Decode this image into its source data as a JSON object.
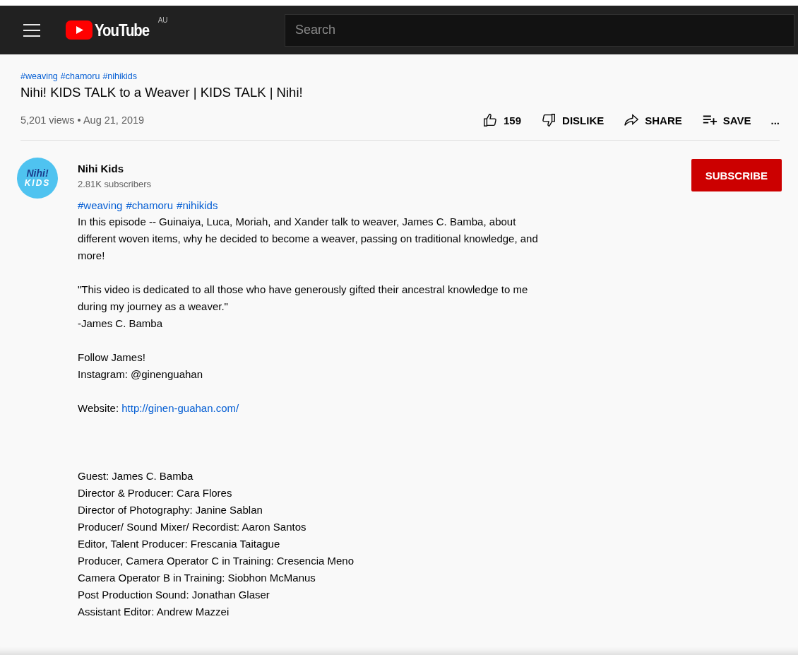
{
  "header": {
    "logo_text": "YouTube",
    "region": "AU",
    "search": {
      "placeholder": "Search"
    }
  },
  "video": {
    "hashtags": [
      "#weaving",
      "#chamoru",
      "#nihikids"
    ],
    "title": "Nihi! KIDS TALK to a Weaver | KIDS TALK | Nihi!",
    "meta": "5,201 views • Aug 21, 2019",
    "actions": [
      {
        "kind": "like",
        "label": "159"
      },
      {
        "kind": "dislike",
        "label": "DISLIKE"
      },
      {
        "kind": "share",
        "label": "SHARE"
      },
      {
        "kind": "save",
        "label": "SAVE"
      },
      {
        "kind": "more",
        "label": "..."
      }
    ]
  },
  "channel": {
    "name": "Nihi Kids",
    "avatar_text": [
      "Nihi!",
      "KIDS"
    ],
    "subscribers": "2.81K subscribers",
    "subscribe": "SUBSCRIBE"
  },
  "description": {
    "hashtags": [
      "#weaving",
      "#chamoru",
      "#nihikids"
    ],
    "blocks": [
      {
        "lines": [
          {
            "text": "In this episode -- Guinaiya, Luca, Moriah, and Xander talk to weaver, James C. Bamba, about"
          },
          {
            "text": "different woven items, why he decided to become a weaver, passing on traditional knowledge, and"
          },
          {
            "text": "more!"
          }
        ]
      },
      {
        "lines": [
          {
            "text": "\"This video is dedicated to all those who have generously gifted their ancestral knowledge to me"
          },
          {
            "text": "during my journey as a weaver.\""
          },
          {
            "text": "-James C. Bamba"
          }
        ]
      },
      {
        "lines": [
          {
            "text": "Follow James!"
          },
          {
            "text": "Instagram: @ginenguahan"
          }
        ]
      },
      {
        "lines": [
          {
            "text": "Website:",
            "link": "http://ginen-guahan.com/"
          }
        ]
      }
    ],
    "credits": [
      {
        "text": "Guest: James C. Bamba"
      },
      {
        "text": "Director & Producer: Cara Flores"
      },
      {
        "text": "Director of Photography: Janine Sablan"
      },
      {
        "text": "Producer/ Sound Mixer/ Recordist: Aaron Santos"
      },
      {
        "text": "Editor, Talent Producer: Frescania Taitague"
      },
      {
        "text": "Producer, Camera Operator C in Training: Cresencia Meno"
      },
      {
        "text": "Camera Operator B in Training: Siobhon McManus"
      },
      {
        "text": "Post Production Sound: Jonathan Glaser"
      },
      {
        "text": "Assistant Editor: Andrew Mazzei"
      }
    ]
  }
}
